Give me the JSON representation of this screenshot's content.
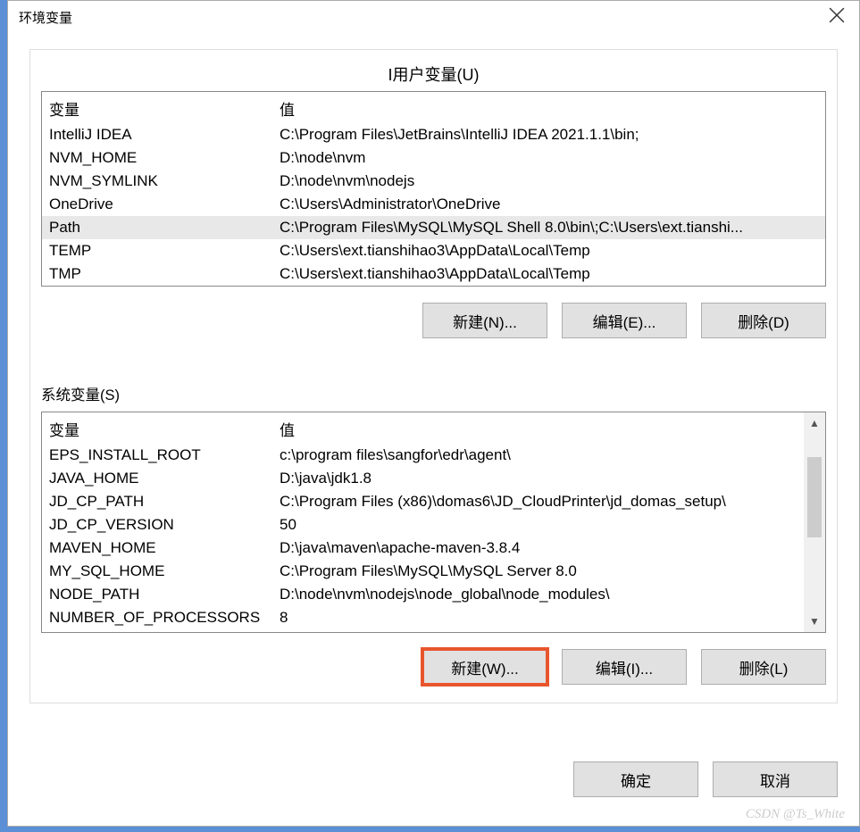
{
  "dialog_title": "环境变量",
  "user_section_label": "I用户变量(U)",
  "system_section_label": "系统变量(S)",
  "columns": {
    "variable": "变量",
    "value": "值"
  },
  "user_vars": [
    {
      "name": "IntelliJ IDEA",
      "value": "C:\\Program Files\\JetBrains\\IntelliJ IDEA 2021.1.1\\bin;",
      "selected": false
    },
    {
      "name": "NVM_HOME",
      "value": "D:\\node\\nvm",
      "selected": false
    },
    {
      "name": "NVM_SYMLINK",
      "value": "D:\\node\\nvm\\nodejs",
      "selected": false
    },
    {
      "name": "OneDrive",
      "value": "C:\\Users\\Administrator\\OneDrive",
      "selected": false
    },
    {
      "name": "Path",
      "value": "C:\\Program Files\\MySQL\\MySQL Shell 8.0\\bin\\;C:\\Users\\ext.tianshi...",
      "selected": true
    },
    {
      "name": "TEMP",
      "value": "C:\\Users\\ext.tianshihao3\\AppData\\Local\\Temp",
      "selected": false
    },
    {
      "name": "TMP",
      "value": "C:\\Users\\ext.tianshihao3\\AppData\\Local\\Temp",
      "selected": false
    }
  ],
  "system_vars": [
    {
      "name": "EPS_INSTALL_ROOT",
      "value": "c:\\program files\\sangfor\\edr\\agent\\"
    },
    {
      "name": "JAVA_HOME",
      "value": "D:\\java\\jdk1.8"
    },
    {
      "name": "JD_CP_PATH",
      "value": "C:\\Program Files (x86)\\domas6\\JD_CloudPrinter\\jd_domas_setup\\"
    },
    {
      "name": "JD_CP_VERSION",
      "value": "50"
    },
    {
      "name": "MAVEN_HOME",
      "value": "D:\\java\\maven\\apache-maven-3.8.4"
    },
    {
      "name": "MY_SQL_HOME",
      "value": "C:\\Program Files\\MySQL\\MySQL Server 8.0"
    },
    {
      "name": "NODE_PATH",
      "value": "D:\\node\\nvm\\nodejs\\node_global\\node_modules\\"
    },
    {
      "name": "NUMBER_OF_PROCESSORS",
      "value": "8"
    }
  ],
  "buttons": {
    "user_new": "新建(N)...",
    "user_edit": "编辑(E)...",
    "user_delete": "删除(D)",
    "sys_new": "新建(W)...",
    "sys_edit": "编辑(I)...",
    "sys_delete": "删除(L)",
    "ok": "确定",
    "cancel": "取消"
  },
  "watermark": "CSDN @Ts_White"
}
